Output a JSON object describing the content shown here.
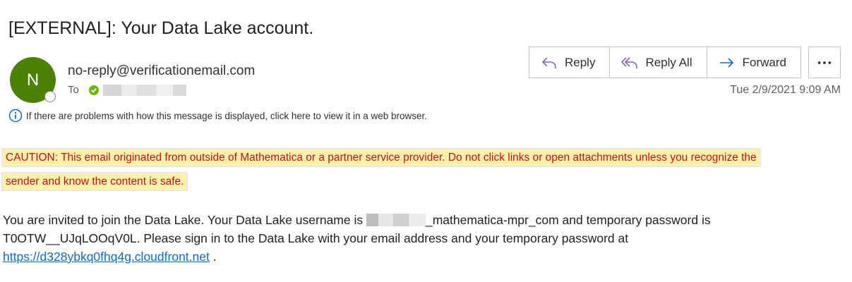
{
  "email": {
    "subject": "[EXTERNAL]: Your Data Lake account.",
    "avatar_initial": "N",
    "sender": "no-reply@verificationemail.com",
    "to_label": "To",
    "timestamp": "Tue 2/9/2021 9:09 AM",
    "display_notice": "If there are problems with how this message is displayed, click here to view it in a web browser."
  },
  "actions": {
    "reply": "Reply",
    "reply_all": "Reply All",
    "forward": "Forward",
    "more": "•••"
  },
  "caution": {
    "line1": "CAUTION: This email originated from outside of Mathematica or a partner service provider. Do not click links or open attachments unless you recognize the",
    "line2": "sender and know the content is safe."
  },
  "body": {
    "part1": "You are invited to join the Data Lake. Your Data Lake username is ",
    "username_suffix": "_mathematica-mpr_com and temporary password is",
    "line2": "T0OTW__UJqLOOqV0L. Please sign in to the Data Lake with your email address and your temporary password at",
    "link": "https://d328ybkq0fhq4g.cloudfront.net",
    "end": " ."
  },
  "colors": {
    "avatar": "#498205",
    "caution_text": "#c50f1f",
    "caution_highlight": "#fff2a8",
    "link": "#0f6cbd",
    "action_icon": "#0f6cbd"
  }
}
